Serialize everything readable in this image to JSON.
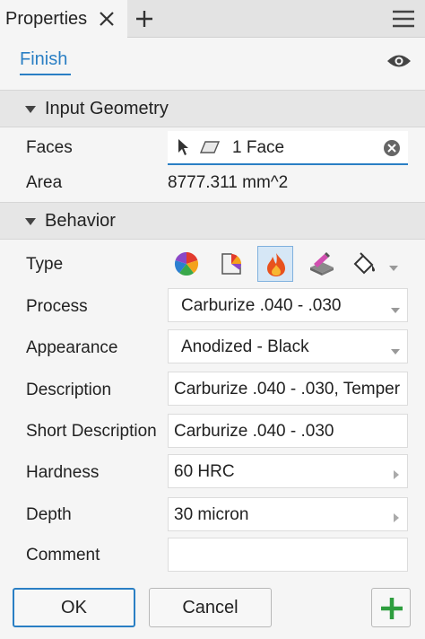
{
  "panel": {
    "tab_title": "Properties",
    "tab_close_icon": "close-icon",
    "tab_add_icon": "plus-icon",
    "menu_icon": "hamburger-menu-icon"
  },
  "header": {
    "link_label": "Finish",
    "visibility_icon": "eye-icon"
  },
  "input_geometry": {
    "title": "Input Geometry",
    "faces_label": "Faces",
    "faces_value": "1 Face",
    "area_label": "Area",
    "area_value": "8777.311 mm^2"
  },
  "behavior": {
    "title": "Behavior",
    "type_label": "Type",
    "type_options": [
      "color-wheel-icon",
      "appearance-icon",
      "heat-treatment-icon",
      "surface-finish-icon",
      "paint-bucket-icon"
    ],
    "type_selected_index": 2,
    "process_label": "Process",
    "process_value": "Carburize .040 - .030",
    "appearance_label": "Appearance",
    "appearance_value": "Anodized - Black",
    "description_label": "Description",
    "description_value": "Carburize .040 - .030, Temper",
    "short_description_label": "Short Description",
    "short_description_value": "Carburize .040 - .030",
    "hardness_label": "Hardness",
    "hardness_value": "60 HRC",
    "depth_label": "Depth",
    "depth_value": "30 micron",
    "comment_label": "Comment",
    "comment_value": ""
  },
  "footer": {
    "ok_label": "OK",
    "cancel_label": "Cancel",
    "add_icon": "green-plus-icon"
  },
  "colors": {
    "accent": "#2a7fc4",
    "add_green": "#2e9e3e",
    "flame": "#e8521e"
  }
}
